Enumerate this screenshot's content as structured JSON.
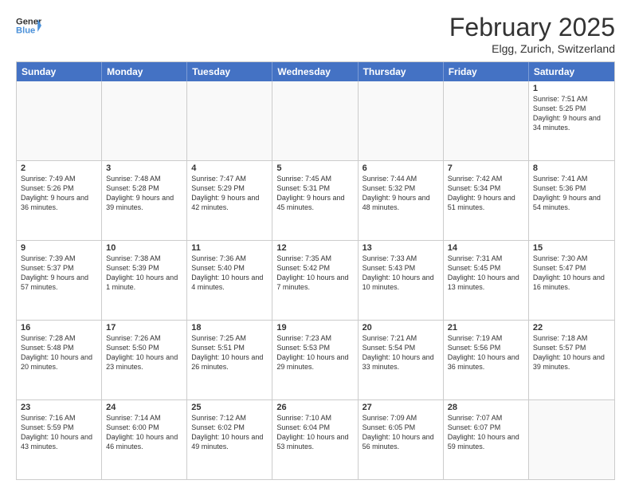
{
  "header": {
    "logo_general": "General",
    "logo_blue": "Blue",
    "title": "February 2025",
    "location": "Elgg, Zurich, Switzerland"
  },
  "weekdays": [
    "Sunday",
    "Monday",
    "Tuesday",
    "Wednesday",
    "Thursday",
    "Friday",
    "Saturday"
  ],
  "rows": [
    [
      {
        "day": "",
        "text": ""
      },
      {
        "day": "",
        "text": ""
      },
      {
        "day": "",
        "text": ""
      },
      {
        "day": "",
        "text": ""
      },
      {
        "day": "",
        "text": ""
      },
      {
        "day": "",
        "text": ""
      },
      {
        "day": "1",
        "text": "Sunrise: 7:51 AM\nSunset: 5:25 PM\nDaylight: 9 hours and 34 minutes."
      }
    ],
    [
      {
        "day": "2",
        "text": "Sunrise: 7:49 AM\nSunset: 5:26 PM\nDaylight: 9 hours and 36 minutes."
      },
      {
        "day": "3",
        "text": "Sunrise: 7:48 AM\nSunset: 5:28 PM\nDaylight: 9 hours and 39 minutes."
      },
      {
        "day": "4",
        "text": "Sunrise: 7:47 AM\nSunset: 5:29 PM\nDaylight: 9 hours and 42 minutes."
      },
      {
        "day": "5",
        "text": "Sunrise: 7:45 AM\nSunset: 5:31 PM\nDaylight: 9 hours and 45 minutes."
      },
      {
        "day": "6",
        "text": "Sunrise: 7:44 AM\nSunset: 5:32 PM\nDaylight: 9 hours and 48 minutes."
      },
      {
        "day": "7",
        "text": "Sunrise: 7:42 AM\nSunset: 5:34 PM\nDaylight: 9 hours and 51 minutes."
      },
      {
        "day": "8",
        "text": "Sunrise: 7:41 AM\nSunset: 5:36 PM\nDaylight: 9 hours and 54 minutes."
      }
    ],
    [
      {
        "day": "9",
        "text": "Sunrise: 7:39 AM\nSunset: 5:37 PM\nDaylight: 9 hours and 57 minutes."
      },
      {
        "day": "10",
        "text": "Sunrise: 7:38 AM\nSunset: 5:39 PM\nDaylight: 10 hours and 1 minute."
      },
      {
        "day": "11",
        "text": "Sunrise: 7:36 AM\nSunset: 5:40 PM\nDaylight: 10 hours and 4 minutes."
      },
      {
        "day": "12",
        "text": "Sunrise: 7:35 AM\nSunset: 5:42 PM\nDaylight: 10 hours and 7 minutes."
      },
      {
        "day": "13",
        "text": "Sunrise: 7:33 AM\nSunset: 5:43 PM\nDaylight: 10 hours and 10 minutes."
      },
      {
        "day": "14",
        "text": "Sunrise: 7:31 AM\nSunset: 5:45 PM\nDaylight: 10 hours and 13 minutes."
      },
      {
        "day": "15",
        "text": "Sunrise: 7:30 AM\nSunset: 5:47 PM\nDaylight: 10 hours and 16 minutes."
      }
    ],
    [
      {
        "day": "16",
        "text": "Sunrise: 7:28 AM\nSunset: 5:48 PM\nDaylight: 10 hours and 20 minutes."
      },
      {
        "day": "17",
        "text": "Sunrise: 7:26 AM\nSunset: 5:50 PM\nDaylight: 10 hours and 23 minutes."
      },
      {
        "day": "18",
        "text": "Sunrise: 7:25 AM\nSunset: 5:51 PM\nDaylight: 10 hours and 26 minutes."
      },
      {
        "day": "19",
        "text": "Sunrise: 7:23 AM\nSunset: 5:53 PM\nDaylight: 10 hours and 29 minutes."
      },
      {
        "day": "20",
        "text": "Sunrise: 7:21 AM\nSunset: 5:54 PM\nDaylight: 10 hours and 33 minutes."
      },
      {
        "day": "21",
        "text": "Sunrise: 7:19 AM\nSunset: 5:56 PM\nDaylight: 10 hours and 36 minutes."
      },
      {
        "day": "22",
        "text": "Sunrise: 7:18 AM\nSunset: 5:57 PM\nDaylight: 10 hours and 39 minutes."
      }
    ],
    [
      {
        "day": "23",
        "text": "Sunrise: 7:16 AM\nSunset: 5:59 PM\nDaylight: 10 hours and 43 minutes."
      },
      {
        "day": "24",
        "text": "Sunrise: 7:14 AM\nSunset: 6:00 PM\nDaylight: 10 hours and 46 minutes."
      },
      {
        "day": "25",
        "text": "Sunrise: 7:12 AM\nSunset: 6:02 PM\nDaylight: 10 hours and 49 minutes."
      },
      {
        "day": "26",
        "text": "Sunrise: 7:10 AM\nSunset: 6:04 PM\nDaylight: 10 hours and 53 minutes."
      },
      {
        "day": "27",
        "text": "Sunrise: 7:09 AM\nSunset: 6:05 PM\nDaylight: 10 hours and 56 minutes."
      },
      {
        "day": "28",
        "text": "Sunrise: 7:07 AM\nSunset: 6:07 PM\nDaylight: 10 hours and 59 minutes."
      },
      {
        "day": "",
        "text": ""
      }
    ]
  ]
}
